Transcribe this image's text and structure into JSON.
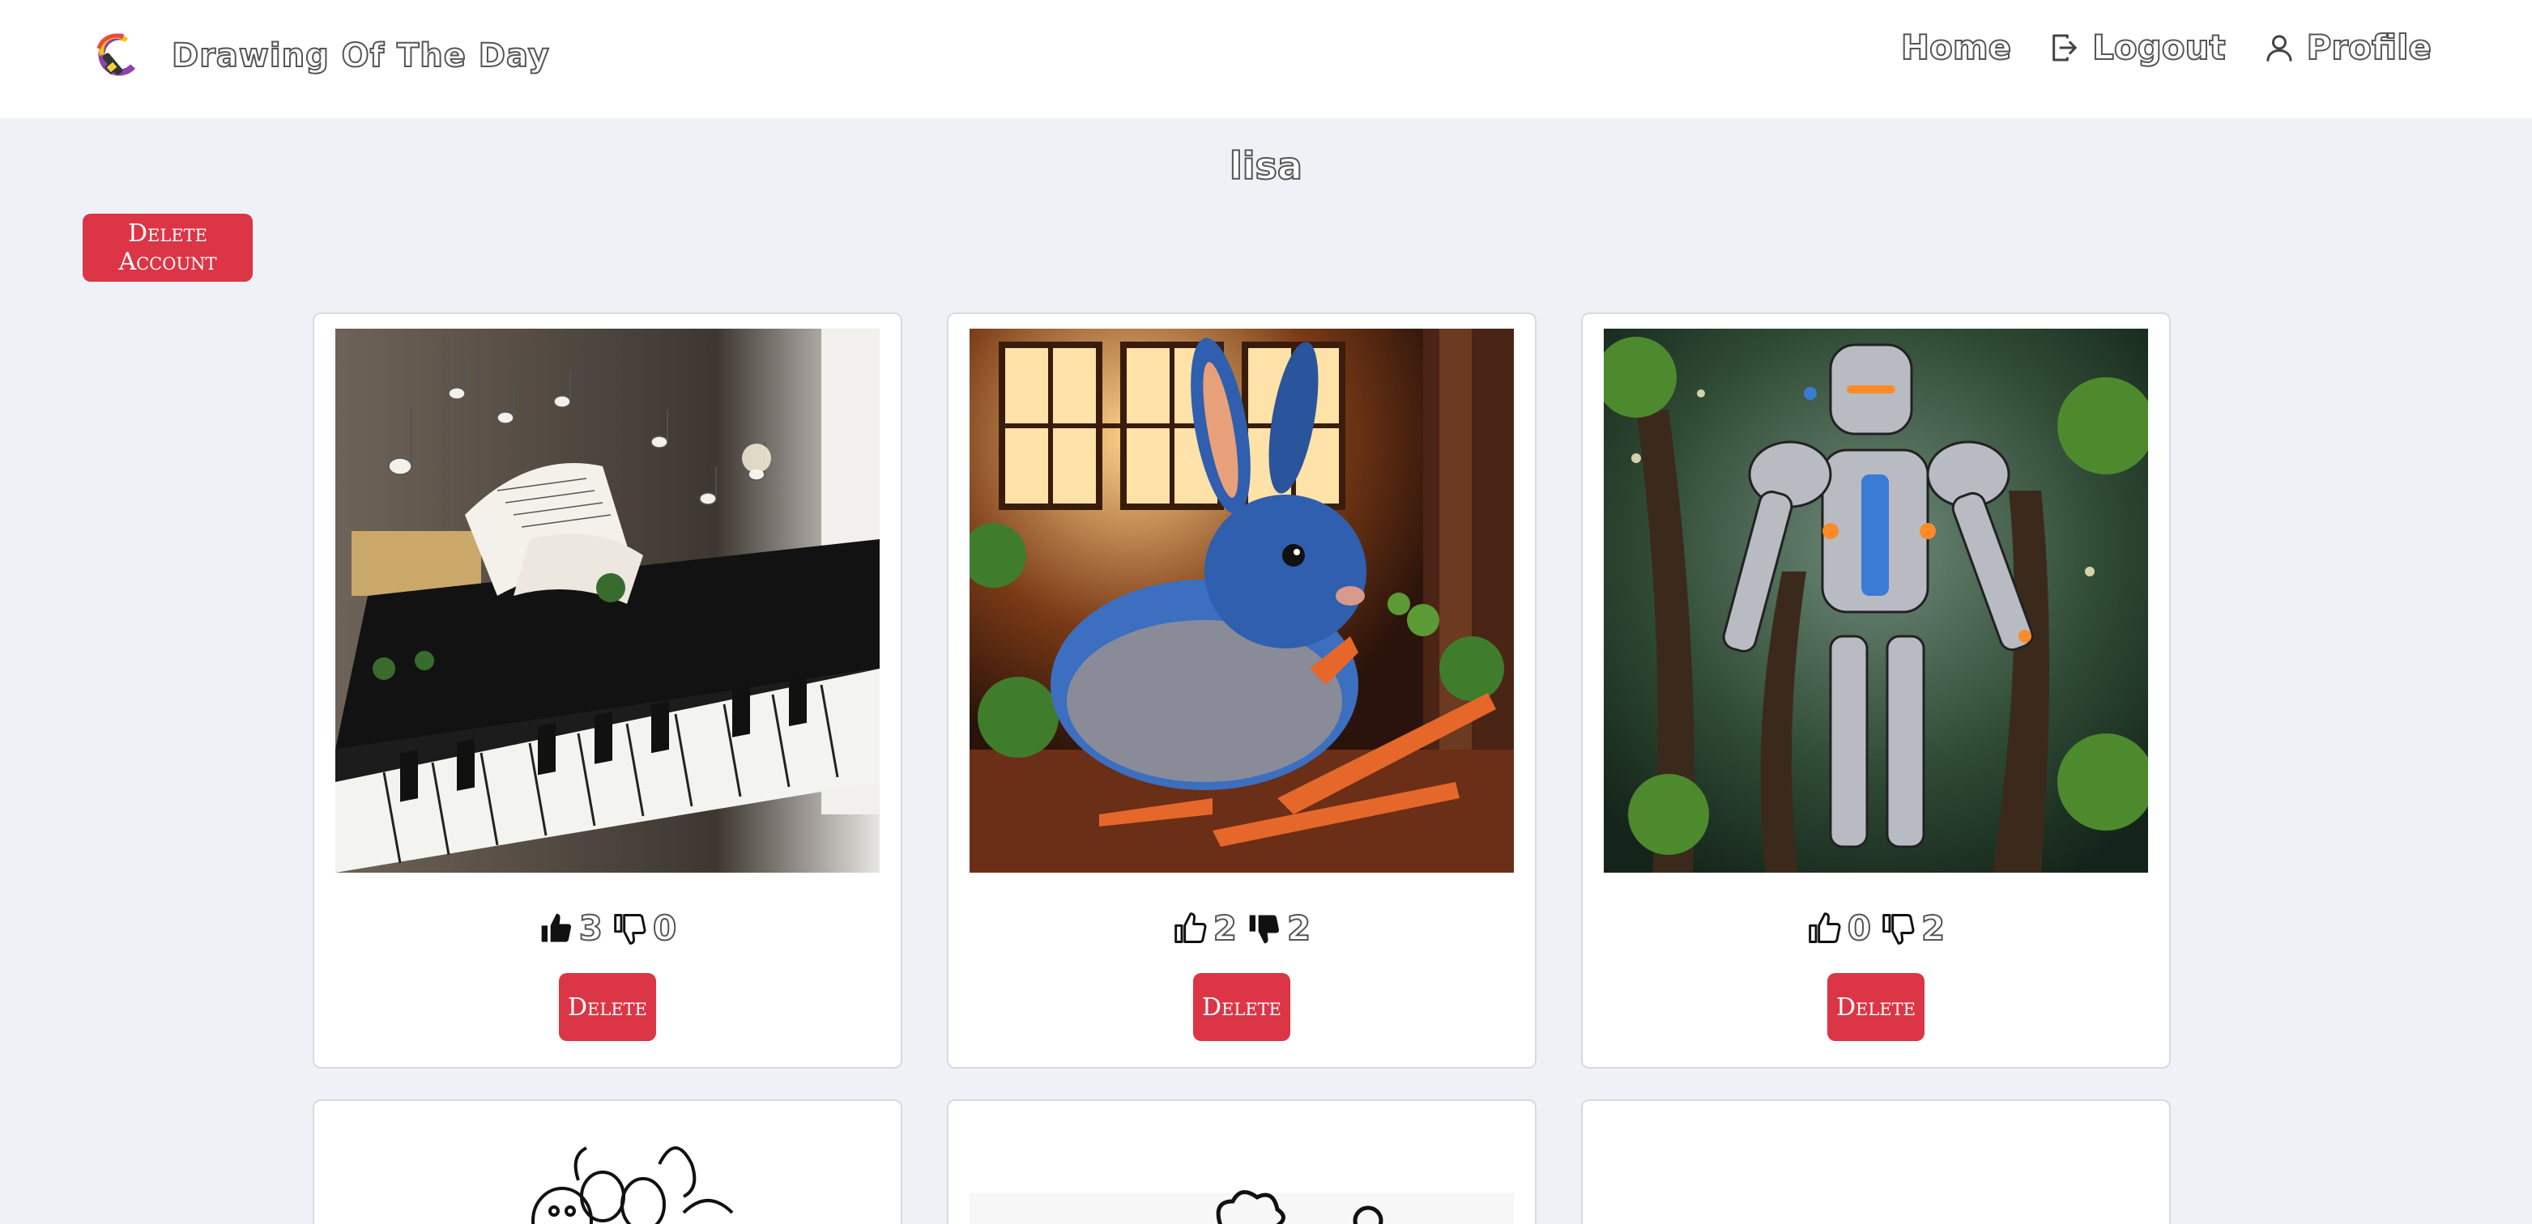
{
  "navbar": {
    "brand": "Drawing Of The Day",
    "links": [
      {
        "label": "Home",
        "icon": "none"
      },
      {
        "label": "Logout",
        "icon": "logout-icon"
      },
      {
        "label": "Profile",
        "icon": "user-icon"
      }
    ]
  },
  "profile": {
    "username": "lisa",
    "delete_account_label": "Delete Account"
  },
  "posts": [
    {
      "image": "piano with flying sheet music and notes",
      "likes": "3",
      "dislikes": "0",
      "liked": true,
      "disliked": false,
      "delete_label": "Delete"
    },
    {
      "image": "blue rabbit eating carrots",
      "likes": "2",
      "dislikes": "2",
      "liked": false,
      "disliked": true,
      "delete_label": "Delete"
    },
    {
      "image": "silver robot in forest",
      "likes": "0",
      "dislikes": "2",
      "liked": false,
      "disliked": false,
      "delete_label": "Delete"
    }
  ],
  "colors": {
    "danger": "#dc3545",
    "page_bg": "#eef1f6",
    "navbar_bg": "#ffffff"
  }
}
